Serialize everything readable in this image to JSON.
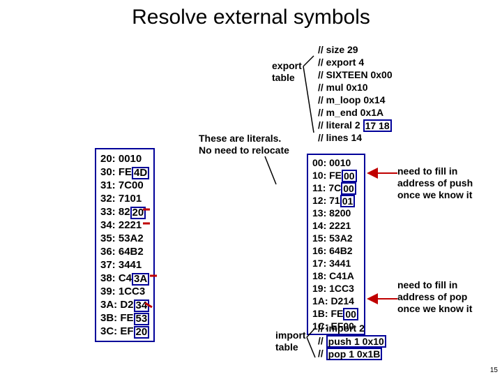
{
  "title": "Resolve external symbols",
  "left_box": {
    "lines": [
      "20: 0010",
      "30: FE4D",
      "31: 7C00",
      "32: 7101",
      "33: 8220",
      "34: 2221",
      "35: 53A2",
      "36: 64B2",
      "37: 3441",
      "38: C43A",
      "39: 1CC3",
      "3A: D234",
      "3B: FE53",
      "3C: EF20"
    ]
  },
  "right_box": {
    "lines": [
      "00: 0010",
      "10: FE00",
      "11: 7C00",
      "12: 7101",
      "13: 8200",
      "14: 2221",
      "15: 53A2",
      "16: 64B2",
      "17: 3441",
      "18: C41A",
      "19: 1CC3",
      "1A: D214",
      "1B: FE00",
      "1C: EF00"
    ]
  },
  "export_table_label": "export\ntable",
  "import_table_label": "import\ntable",
  "export_comments": [
    "// size 29",
    "// export 4",
    "// SIXTEEN 0x00",
    "// mul 0x10",
    "// m_loop 0x14",
    "// m_end 0x1A",
    "// literal 2 17 18",
    "// lines 14"
  ],
  "import_comments": [
    "// import 2",
    "// push 1 0x10",
    "// pop 1 0x1B"
  ],
  "literals_note_l1": "These are literals.",
  "literals_note_l2": "No need to relocate",
  "push_note_l1": "need to fill in",
  "push_note_l2": "address of push",
  "push_note_l3": "once we know it",
  "pop_note_l1": "need to fill in",
  "pop_note_l2": "address of pop",
  "pop_note_l3": "once we know it",
  "pagenum": "15"
}
